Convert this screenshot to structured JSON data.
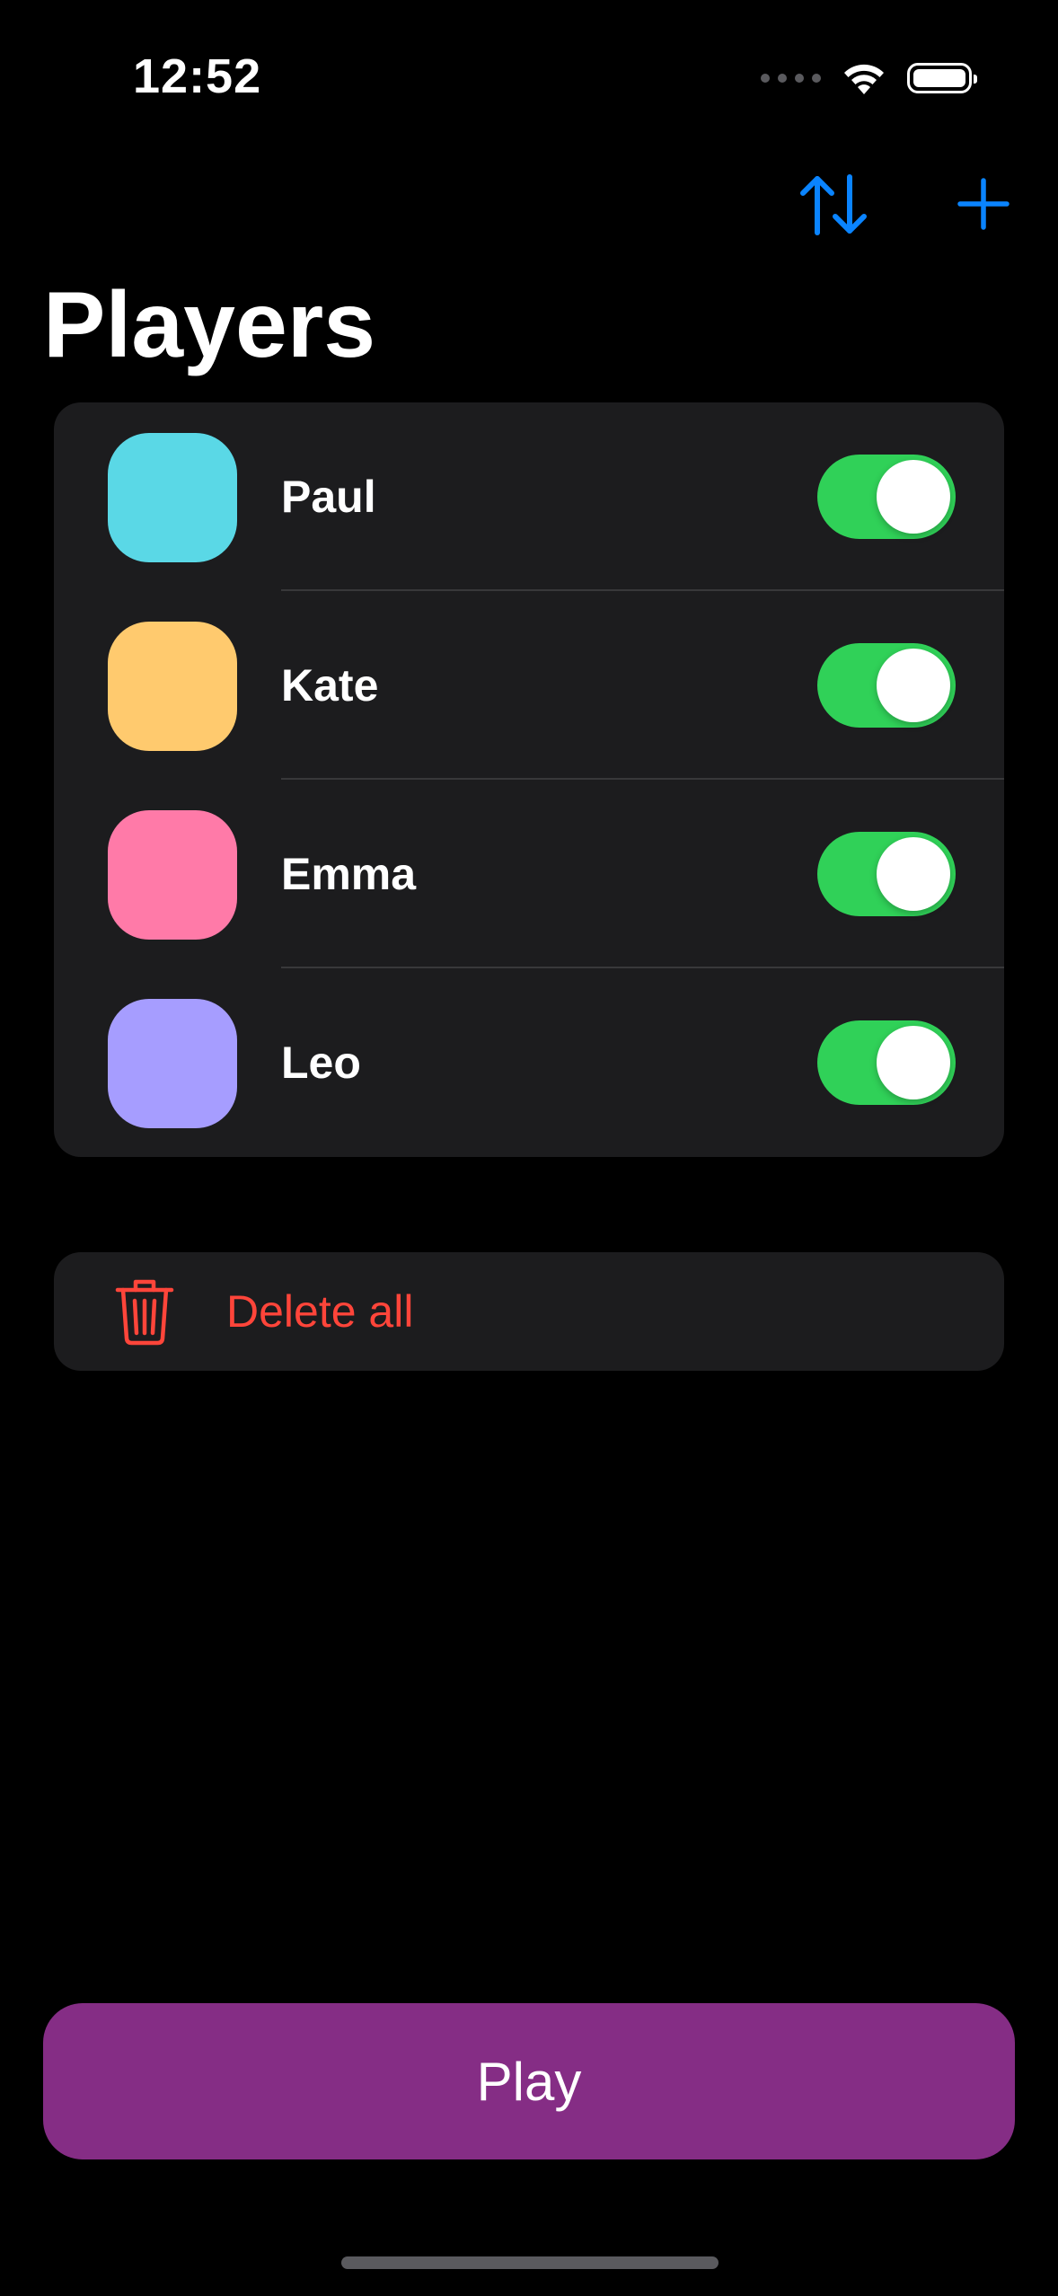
{
  "status_bar": {
    "time": "12:52"
  },
  "nav": {
    "sort_icon": "arrow-up-down-icon",
    "add_icon": "plus-icon",
    "accent_color": "#0a84ff"
  },
  "page": {
    "title": "Players"
  },
  "players": [
    {
      "name": "Paul",
      "color": "#5ad8e6",
      "enabled": true
    },
    {
      "name": "Kate",
      "color": "#ffca6e",
      "enabled": true
    },
    {
      "name": "Emma",
      "color": "#ff7aa8",
      "enabled": true
    },
    {
      "name": "Leo",
      "color": "#a69dff",
      "enabled": true
    }
  ],
  "actions": {
    "delete_all_label": "Delete all",
    "delete_icon": "trash-icon",
    "delete_color": "#ff453a",
    "play_label": "Play",
    "play_color": "#852d85"
  },
  "toggle_on_color": "#30d158"
}
